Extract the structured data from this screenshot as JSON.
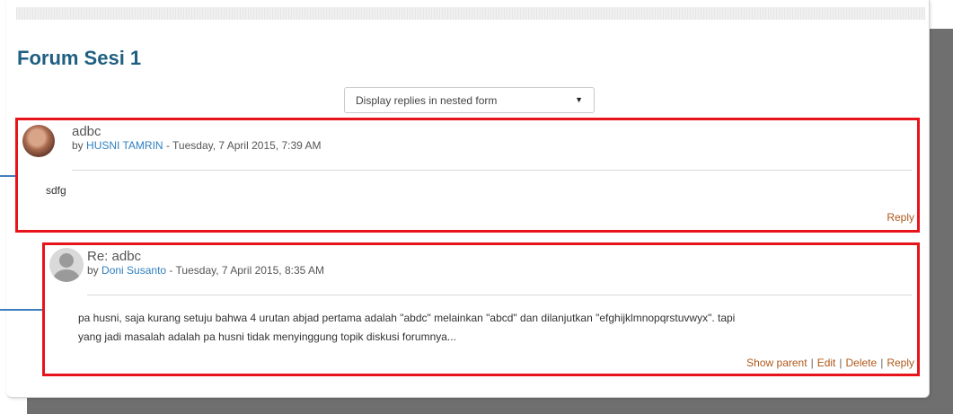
{
  "forum": {
    "title": "Forum Sesi 1",
    "display_mode": "Display replies in nested form"
  },
  "posts": [
    {
      "subject": "adbc",
      "by_prefix": "by",
      "author": "HUSNI TAMRIN",
      "date": "- Tuesday, 7 April 2015, 7:39 AM",
      "message": "sdfg",
      "commands": [
        "Reply"
      ]
    },
    {
      "subject": "Re: adbc",
      "by_prefix": "by",
      "author": "Doni Susanto",
      "date": "- Tuesday, 7 April 2015, 8:35 AM",
      "message_lines": [
        "pa husni, saja kurang setuju bahwa 4 urutan abjad pertama adalah \"abdc\" melainkan \"abcd\" dan dilanjutkan \"efghijklmnopqrstuvwyx\". tapi",
        "yang jadi masalah adalah pa husni tidak menyinggung topik diskusi forumnya..."
      ],
      "commands": [
        "Show parent",
        "Edit",
        "Delete",
        "Reply"
      ],
      "separator": "|"
    }
  ],
  "colors": {
    "title": "#1f5f82",
    "highlight_border": "#e8141b",
    "author_link": "#2f7fbf",
    "command_link": "#b0581a",
    "connector": "#3f7fbf"
  },
  "icons": {
    "select_arrow": "triangle-down-icon",
    "generic_avatar": "user-placeholder-icon"
  }
}
